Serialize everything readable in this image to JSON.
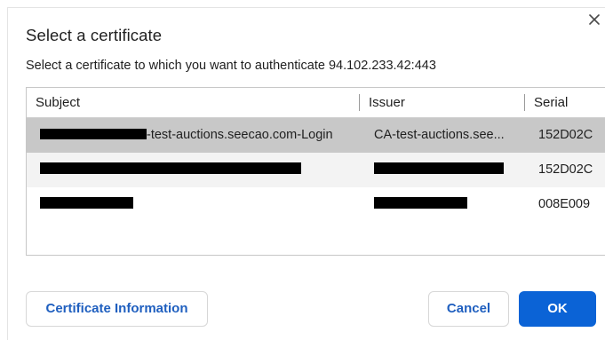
{
  "dialog": {
    "title": "Select a certificate",
    "subtitle": "Select a certificate to which you want to authenticate 94.102.233.42:443",
    "close_icon": "close-icon"
  },
  "table": {
    "columns": [
      "Subject",
      "Issuer",
      "Serial"
    ],
    "rows": [
      {
        "subject": "-test-auctions.seecao.com-Login",
        "issuer": "CA-test-auctions.see...",
        "serial": "152D02C",
        "selected": true,
        "subject_redacted": true,
        "issuer_redacted": false
      },
      {
        "subject": "",
        "issuer": "",
        "serial": "152D02C",
        "selected": false,
        "subject_redacted": true,
        "issuer_redacted": true
      },
      {
        "subject": "",
        "issuer": "",
        "serial": "008E009",
        "selected": false,
        "subject_redacted": true,
        "issuer_redacted": true
      }
    ]
  },
  "buttons": {
    "certificate_information": "Certificate Information",
    "cancel": "Cancel",
    "ok": "OK"
  },
  "colors": {
    "primary": "#0b63d6",
    "secondary_text": "#1f5fbf",
    "selected_row": "#c8c8c8",
    "alt_row": "#f3f3f3"
  }
}
